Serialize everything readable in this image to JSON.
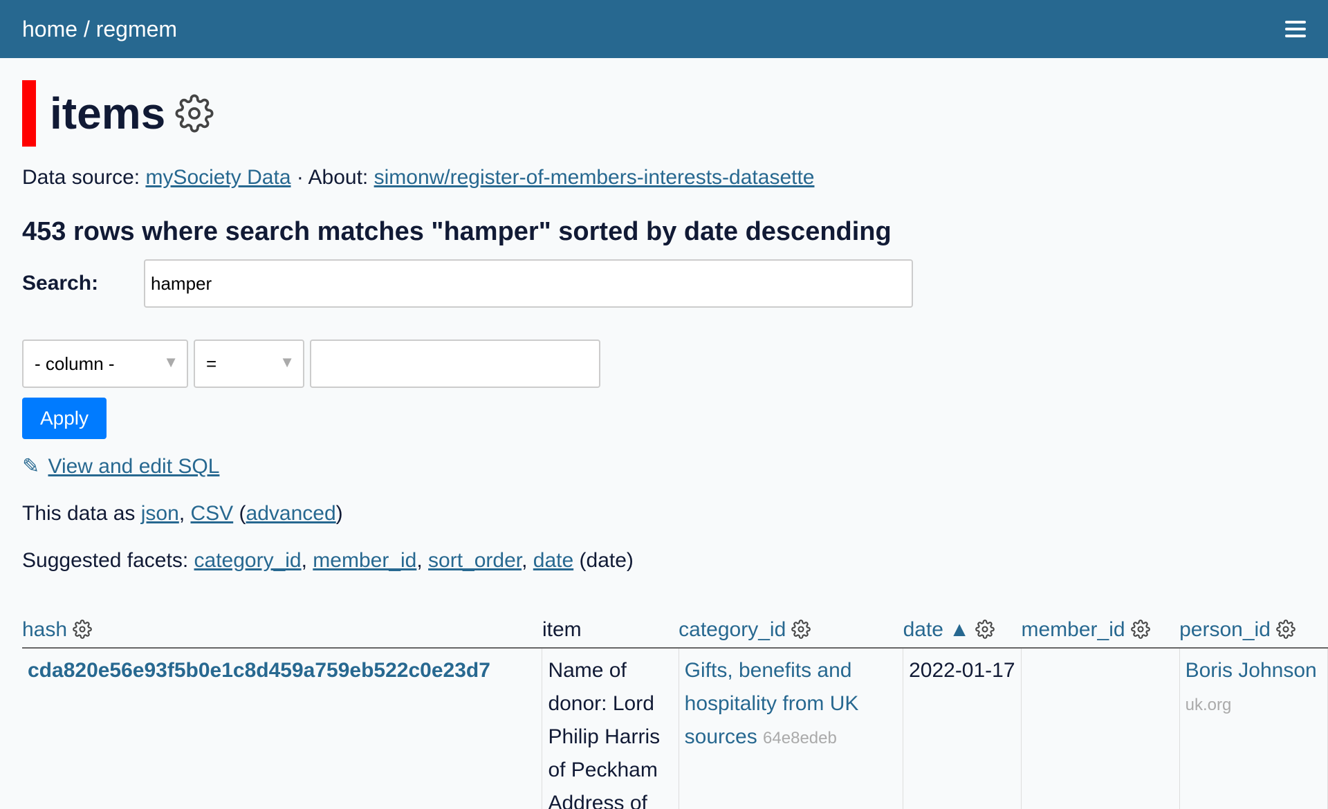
{
  "header": {
    "crumbs": [
      {
        "label": "home"
      },
      {
        "label": "regmem"
      }
    ],
    "separator": "/"
  },
  "page": {
    "title": "items",
    "source_prefix": "Data source:",
    "source_link": "mySociety Data",
    "about_prefix": "· About:",
    "about_link": "simonw/register-of-members-interests-datasette",
    "summary": "453 rows where search matches \"hamper\" sorted by date descending"
  },
  "search": {
    "label": "Search:",
    "value": "hamper"
  },
  "filters": {
    "column_select": "- column -",
    "operator_select": "=",
    "value": "",
    "apply_label": "Apply"
  },
  "sql": {
    "pencil": "✎",
    "link": "View and edit SQL"
  },
  "export": {
    "prefix": "This data as",
    "json": "json",
    "comma": ",",
    "csv": "CSV",
    "open": "(",
    "advanced": "advanced",
    "close": ")"
  },
  "facets": {
    "prefix": "Suggested facets:",
    "items": [
      "category_id",
      "member_id",
      "sort_order",
      "date"
    ],
    "suffix": "(date)"
  },
  "table": {
    "columns": [
      {
        "label": "hash",
        "sortable": true
      },
      {
        "label": "item",
        "sortable": false
      },
      {
        "label": "category_id",
        "sortable": true
      },
      {
        "label": "date ▲",
        "sortable": true
      },
      {
        "label": "member_id",
        "sortable": true
      },
      {
        "label": "person_id",
        "sortable": true
      }
    ],
    "rows": [
      {
        "hash": "cda820e56e93f5b0e1c8d459a759eb522c0e23d7",
        "item": "Name of donor: Lord Philip Harris of Peckham Address of",
        "category": "Gifts, benefits and hospitality from UK sources",
        "category_id": "64e8edeb",
        "date": "2022-01-17",
        "member_id": "",
        "person": "Boris Johnson",
        "person_id": "uk.org"
      }
    ]
  }
}
